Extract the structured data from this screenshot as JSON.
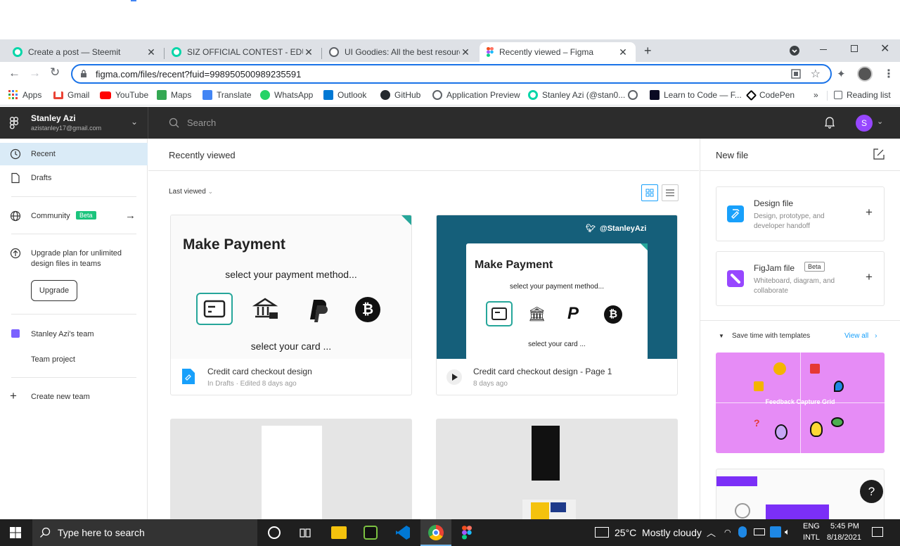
{
  "browser": {
    "tabs": [
      {
        "title": "Create a post — Steemit",
        "favicon_color": "#06d6a9"
      },
      {
        "title": "SIZ OFFICIAL CONTEST - EDUACT",
        "favicon_color": "#06d6a9"
      },
      {
        "title": "UI Goodies: All the best resource",
        "favicon_color": "#5f6368"
      },
      {
        "title": "Recently viewed – Figma",
        "favicon_color": "#f24e1e"
      }
    ],
    "new_tab": "+",
    "url": "figma.com/files/recent?fuid=998950500989235591",
    "bookmarks": [
      {
        "label": "Apps",
        "icon": "apps-grid-icon",
        "color": "#ea4335"
      },
      {
        "label": "Gmail",
        "icon": "gmail-icon",
        "color": "#ea4335"
      },
      {
        "label": "YouTube",
        "icon": "youtube-icon",
        "color": "#ff0000"
      },
      {
        "label": "Maps",
        "icon": "maps-icon",
        "color": "#34a853"
      },
      {
        "label": "Translate",
        "icon": "translate-icon",
        "color": "#4285f4"
      },
      {
        "label": "WhatsApp",
        "icon": "whatsapp-icon",
        "color": "#25d366"
      },
      {
        "label": "Outlook",
        "icon": "outlook-icon",
        "color": "#0078d4"
      },
      {
        "label": "GitHub",
        "icon": "github-icon",
        "color": "#24292e"
      },
      {
        "label": "Application Preview",
        "icon": "globe-icon",
        "color": "#5f6368"
      },
      {
        "label": "Stanley Azi (@stan0...",
        "icon": "steemit-icon",
        "color": "#06d6a9"
      },
      {
        "label": "",
        "icon": "globe-icon",
        "color": "#5f6368"
      },
      {
        "label": "Learn to Code — F...",
        "icon": "fcc-icon",
        "color": "#0a0a23"
      },
      {
        "label": "CodePen",
        "icon": "codepen-icon",
        "color": "#000000"
      }
    ],
    "more_bookmarks": "»",
    "reading_list": "Reading list"
  },
  "figma": {
    "user": {
      "name": "Stanley Azi",
      "email": "azistanley17@gmail.com",
      "avatar_letter": "S",
      "avatar_color": "#9747ff"
    },
    "search_placeholder": "Search",
    "sidebar": {
      "recent": "Recent",
      "drafts": "Drafts",
      "community": "Community",
      "community_badge": "Beta",
      "upgrade_text": "Upgrade plan for unlimited design files in teams",
      "upgrade_button": "Upgrade",
      "team": "Stanley Azi's team",
      "team_project": "Team project",
      "create_team": "Create new team"
    },
    "main": {
      "title": "Recently viewed",
      "sort_label": "Last viewed",
      "files": [
        {
          "name": "Credit card checkout design",
          "meta": "In Drafts · Edited 8 days ago"
        },
        {
          "name": "Credit card checkout design - Page 1",
          "meta": "8 days ago"
        }
      ],
      "thumb1": {
        "heading": "Make Payment",
        "sub": "select your payment method...",
        "card": "select your card ..."
      },
      "thumb2": {
        "handle": "@StanleyAzi",
        "heading": "Make Payment",
        "sub": "select your payment method...",
        "card": "select your card ..."
      }
    },
    "right": {
      "title": "New file",
      "design_file": {
        "title": "Design file",
        "desc": "Design, prototype, and developer handoff"
      },
      "figjam_file": {
        "title": "FigJam file",
        "badge": "Beta",
        "desc": "Whiteboard, diagram, and collaborate"
      },
      "templates_label": "Save time with templates",
      "view_all": "View all",
      "template1": "Feedback Capture Grid"
    },
    "help": "?"
  },
  "taskbar": {
    "search_placeholder": "Type here to search",
    "weather": "25°C  Mostly cloudy",
    "lang1": "ENG",
    "lang2": "INTL",
    "time": "5:45 PM",
    "date": "8/18/2021"
  }
}
